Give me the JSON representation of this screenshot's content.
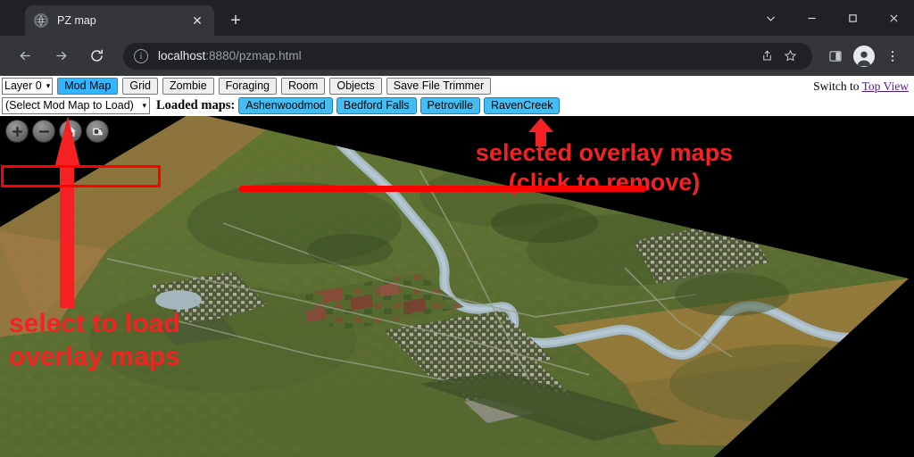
{
  "window": {
    "controls": [
      {
        "name": "tab-search",
        "glyph": "chevron-down"
      },
      {
        "name": "minimize",
        "glyph": "minus"
      },
      {
        "name": "maximize",
        "glyph": "square"
      },
      {
        "name": "close",
        "glyph": "x"
      }
    ]
  },
  "tab": {
    "title": "PZ map",
    "favicon": "globe-icon",
    "close_label": "✕",
    "new_tab_label": "+"
  },
  "omnibox": {
    "scheme_icon": "info-circle-icon",
    "info_glyph": "i",
    "url_host": "localhost",
    "url_rest": ":8880/pzmap.html",
    "actions": [
      "share-icon",
      "bookmark-star-icon"
    ],
    "right_icons": [
      "side-panel-icon",
      "profile-avatar",
      "more-menu-icon"
    ]
  },
  "nav": {
    "back": "←",
    "forward": "→",
    "reload": "⟳"
  },
  "toolbar": {
    "layer_select": "Layer 0",
    "caret": "▾",
    "buttons": [
      {
        "label": "Mod Map",
        "active": true
      },
      {
        "label": "Grid",
        "active": false
      },
      {
        "label": "Zombie",
        "active": false
      },
      {
        "label": "Foraging",
        "active": false
      },
      {
        "label": "Room",
        "active": false
      },
      {
        "label": "Objects",
        "active": false
      },
      {
        "label": "Save File Trimmer",
        "active": false
      }
    ],
    "switch_prefix": "Switch to ",
    "switch_link": "Top View"
  },
  "maprow": {
    "mod_select_value": "(Select Mod Map to Load)",
    "caret": "▾",
    "loaded_label": "Loaded maps:",
    "loaded_maps": [
      "Ashenwoodmod",
      "Bedford Falls",
      "Petroville",
      "RavenCreek"
    ]
  },
  "map_controls": [
    {
      "name": "zoom-in",
      "glyph": "+"
    },
    {
      "name": "zoom-out",
      "glyph": "−"
    },
    {
      "name": "home",
      "glyph": "house"
    },
    {
      "name": "fit-view",
      "glyph": "frame"
    }
  ],
  "annotations": {
    "left_note": "select to load\noverlay maps",
    "right_note": "selected overlay maps\n(click to remove)",
    "color": "#f42222"
  },
  "colors": {
    "accent_chip": "#45bdf0",
    "active_button": "#33b5ff",
    "annotation_red": "#f42222",
    "link_visited": "#551a8b",
    "map_grass": "#5d7233",
    "map_dirt": "#a9793f",
    "map_water": "#9fb6c4",
    "browser_chrome": "#35363a",
    "tabstrip": "#202124"
  }
}
